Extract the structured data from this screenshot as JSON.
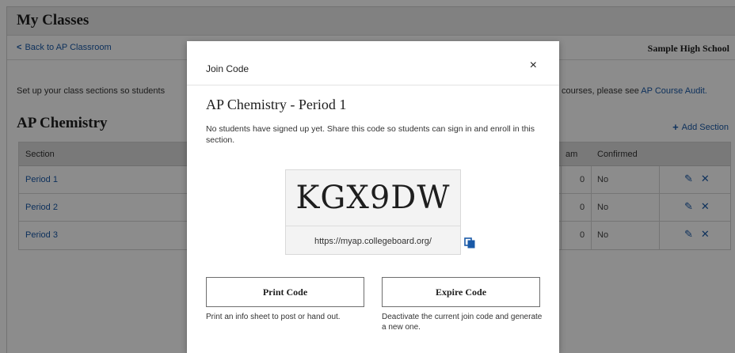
{
  "page": {
    "title": "My Classes",
    "back_link": "Back to AP Classroom",
    "school": "Sample High School",
    "intro_left": "Set up your class sections so students",
    "intro_right_prefix": "courses, please see ",
    "intro_right_link": "AP Course Audit."
  },
  "course": {
    "name": "AP Chemistry",
    "add_section": "Add Section"
  },
  "table": {
    "headers": {
      "section": "Section",
      "exam": "am",
      "confirmed": "Confirmed"
    },
    "rows": [
      {
        "name": "Period 1",
        "count": "0",
        "confirmed": "No"
      },
      {
        "name": "Period 2",
        "count": "0",
        "confirmed": "No"
      },
      {
        "name": "Period 3",
        "count": "0",
        "confirmed": "No"
      }
    ]
  },
  "modal": {
    "header": "Join Code",
    "close": "×",
    "title": "AP Chemistry - Period 1",
    "description": "No students have signed up yet. Share this code so students can sign in and enroll in this section.",
    "code": "KGX9DW",
    "url": "https://myap.collegeboard.org/",
    "print_button": "Print Code",
    "print_hint": "Print an info sheet to post or hand out.",
    "expire_button": "Expire Code",
    "expire_hint": "Deactivate the current join code and generate a new one."
  },
  "icons": {
    "back": "chevron-left-icon",
    "add": "plus-icon",
    "edit": "edit-icon",
    "remove": "close-icon",
    "copy": "copy-icon"
  },
  "colors": {
    "link": "#1a5aa8",
    "overlay": "rgba(0,0,0,0.45)",
    "title_bar": "#ececec"
  }
}
